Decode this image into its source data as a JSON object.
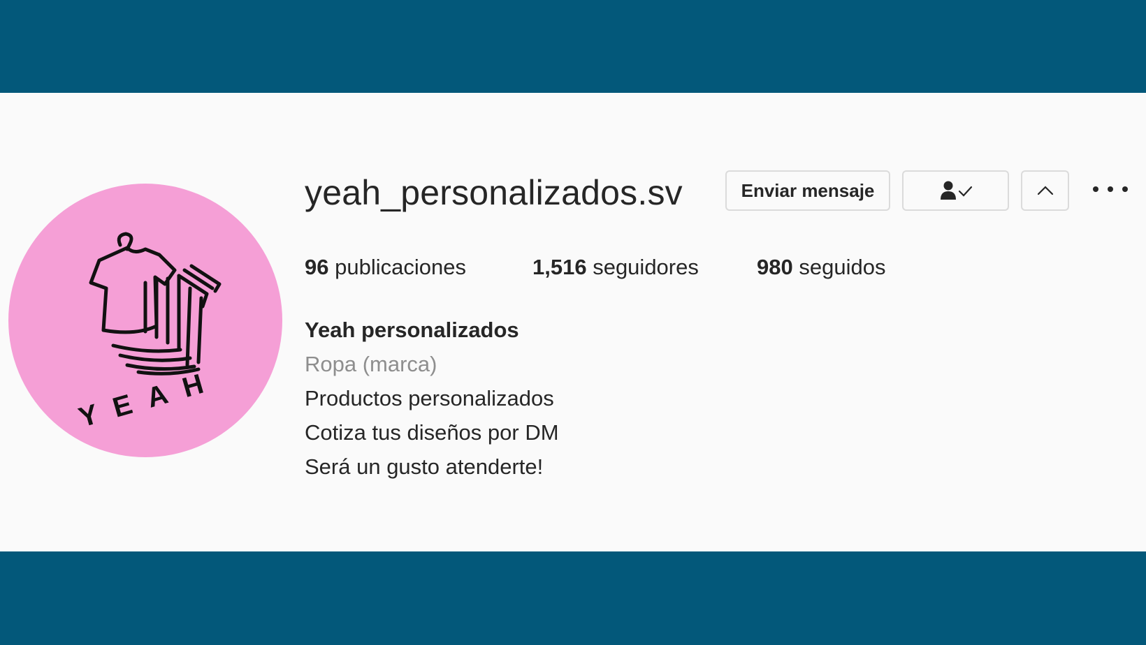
{
  "profile": {
    "username": "yeah_personalizados.sv",
    "avatar_logo_text": "YEAH",
    "buttons": {
      "message_label": "Enviar mensaje",
      "follow_icon": "person-check-icon",
      "suggested_icon": "chevron-up-icon",
      "more_icon": "more-dots-icon"
    },
    "stats": {
      "posts_count": "96",
      "posts_label": "publicaciones",
      "followers_count": "1,516",
      "followers_label": "seguidores",
      "following_count": "980",
      "following_label": "seguidos"
    },
    "bio": {
      "full_name": "Yeah personalizados",
      "category": "Ropa (marca)",
      "lines": [
        "Productos personalizados",
        "Cotiza tus diseños por DM",
        "Será un gusto atenderte!"
      ]
    }
  },
  "colors": {
    "frame": "#03587a",
    "panel": "#fafafa",
    "avatar_bg": "#f59fd6",
    "text": "#262626",
    "muted": "#8e8e8e"
  }
}
